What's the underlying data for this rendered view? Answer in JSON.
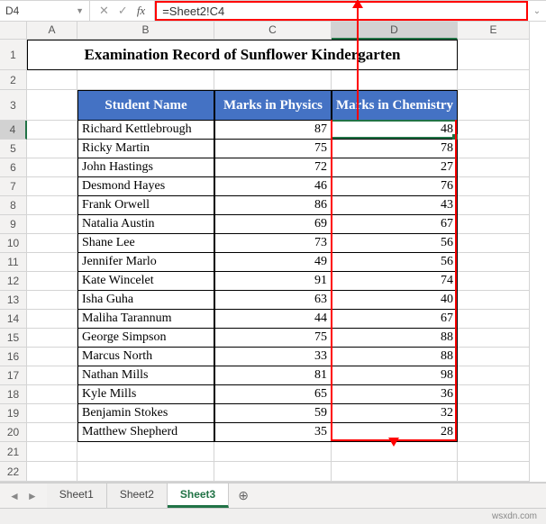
{
  "namebox": "D4",
  "formula": "=Sheet2!C4",
  "columns": [
    "",
    "A",
    "B",
    "C",
    "D",
    "E"
  ],
  "selected_col_idx": 4,
  "title": "Examination Record of Sunflower Kindergarten",
  "headers": {
    "b": "Student Name",
    "c": "Marks in Physics",
    "d": "Marks in Chemistry"
  },
  "rows": [
    {
      "n": 4,
      "name": "Richard Kettlebrough",
      "phys": 87,
      "chem": 48
    },
    {
      "n": 5,
      "name": "Ricky Martin",
      "phys": 75,
      "chem": 78
    },
    {
      "n": 6,
      "name": "John Hastings",
      "phys": 72,
      "chem": 27
    },
    {
      "n": 7,
      "name": "Desmond Hayes",
      "phys": 46,
      "chem": 76
    },
    {
      "n": 8,
      "name": "Frank Orwell",
      "phys": 86,
      "chem": 43
    },
    {
      "n": 9,
      "name": "Natalia Austin",
      "phys": 69,
      "chem": 67
    },
    {
      "n": 10,
      "name": "Shane Lee",
      "phys": 73,
      "chem": 56
    },
    {
      "n": 11,
      "name": "Jennifer Marlo",
      "phys": 49,
      "chem": 56
    },
    {
      "n": 12,
      "name": "Kate Wincelet",
      "phys": 91,
      "chem": 74
    },
    {
      "n": 13,
      "name": "Isha Guha",
      "phys": 63,
      "chem": 40
    },
    {
      "n": 14,
      "name": "Maliha Tarannum",
      "phys": 44,
      "chem": 67
    },
    {
      "n": 15,
      "name": "George Simpson",
      "phys": 75,
      "chem": 88
    },
    {
      "n": 16,
      "name": "Marcus North",
      "phys": 33,
      "chem": 88
    },
    {
      "n": 17,
      "name": "Nathan Mills",
      "phys": 81,
      "chem": 98
    },
    {
      "n": 18,
      "name": "Kyle Mills",
      "phys": 65,
      "chem": 36
    },
    {
      "n": 19,
      "name": "Benjamin Stokes",
      "phys": 59,
      "chem": 32
    },
    {
      "n": 20,
      "name": "Matthew Shepherd",
      "phys": 35,
      "chem": 28
    }
  ],
  "blank_rows": [
    21,
    22
  ],
  "tabs": [
    "Sheet1",
    "Sheet2",
    "Sheet3"
  ],
  "active_tab": "Sheet3",
  "watermark": "wsxdn.com"
}
